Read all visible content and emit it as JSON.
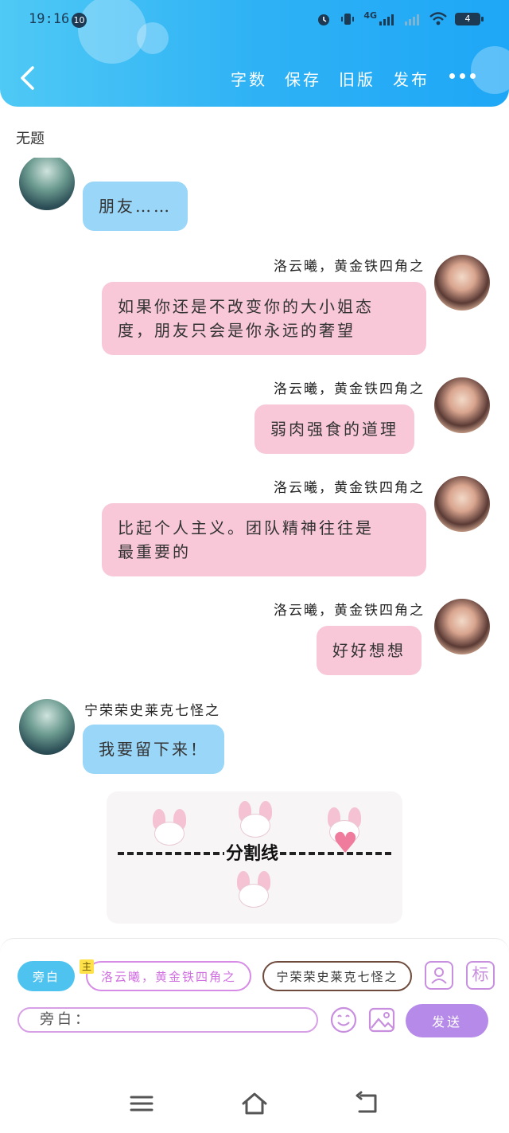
{
  "status_bar": {
    "time": "19:16",
    "notification_count": "10",
    "network": "4G",
    "battery": "4"
  },
  "header": {
    "actions": [
      "字数",
      "保存",
      "旧版",
      "发布"
    ],
    "title": "无题"
  },
  "messages": [
    {
      "side": "left",
      "name": "",
      "text": "朋友……"
    },
    {
      "side": "right",
      "name": "洛云曦，黄金铁四角之",
      "text_lines": [
        "如果你还是不改变你的大小姐态",
        "度，朋友只会是你永远的奢望"
      ]
    },
    {
      "side": "right",
      "name": "洛云曦，黄金铁四角之",
      "text": "弱肉强食的道理"
    },
    {
      "side": "right",
      "name": "洛云曦，黄金铁四角之",
      "text_lines": [
        "比起个人主义。团队精神往往是",
        "最重要的"
      ]
    },
    {
      "side": "right",
      "name": "洛云曦，黄金铁四角之",
      "text": "好好想想"
    },
    {
      "side": "left",
      "name": "宁荣荣史莱克七怪之",
      "text": "我要留下来！"
    }
  ],
  "divider": {
    "label": "分割线"
  },
  "composer": {
    "narrator_chip": "旁白",
    "main_badge": "主",
    "role1_chip": "洛云曦，黄金铁四角之",
    "role2_chip": "宁荣荣史莱克七怪之",
    "mark_button": "标",
    "input_value": "旁白：",
    "send_label": "发送"
  },
  "colors": {
    "header": "#2fb2f5",
    "pink_bubble": "#f9c8d8",
    "blue_bubble": "#9ad6f7",
    "send": "#b68ae8"
  }
}
